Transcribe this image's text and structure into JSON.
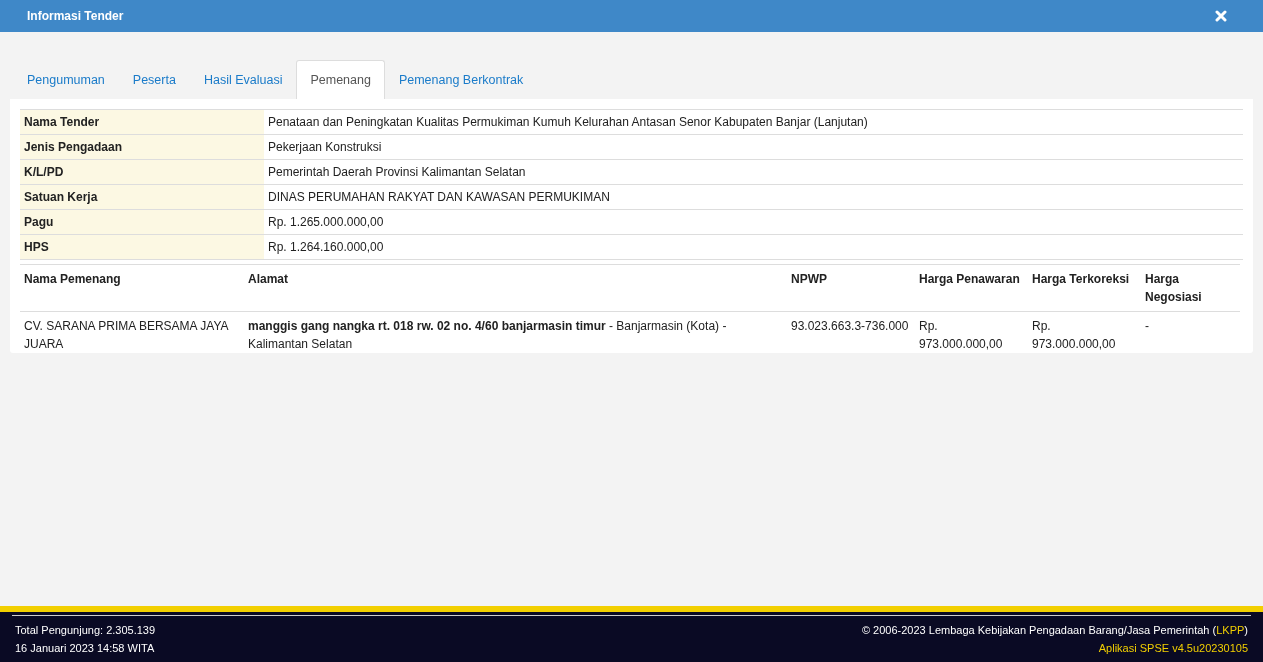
{
  "window": {
    "title": "Informasi Tender"
  },
  "tabs": [
    {
      "label": "Pengumuman",
      "selected": false
    },
    {
      "label": "Peserta",
      "selected": false
    },
    {
      "label": "Hasil Evaluasi",
      "selected": false
    },
    {
      "label": "Pemenang",
      "selected": true
    },
    {
      "label": "Pemenang Berkontrak",
      "selected": false
    }
  ],
  "info": [
    {
      "label": "Nama Tender",
      "value": "Penataan dan Peningkatan Kualitas Permukiman Kumuh Kelurahan Antasan Senor Kabupaten Banjar (Lanjutan)"
    },
    {
      "label": "Jenis Pengadaan",
      "value": "Pekerjaan Konstruksi"
    },
    {
      "label": "K/L/PD",
      "value": "Pemerintah Daerah Provinsi Kalimantan Selatan"
    },
    {
      "label": "Satuan Kerja",
      "value": "DINAS PERUMAHAN RAKYAT DAN KAWASAN PERMUKIMAN"
    },
    {
      "label": "Pagu",
      "value": "Rp. 1.265.000.000,00"
    },
    {
      "label": "HPS",
      "value": "Rp. 1.264.160.000,00"
    }
  ],
  "winners": {
    "columns": [
      "Nama Pemenang",
      "Alamat",
      "NPWP",
      "Harga Penawaran",
      "Harga Terkoreksi",
      "Harga Negosiasi"
    ],
    "rows": [
      [
        "CV. SARANA PRIMA BERSAMA JAYA JUARA",
        "**manggis gang nangka rt. 018 rw. 02 no. 4/60 banjarmasin timur** - Banjarmasin (Kota) - Kalimantan Selatan",
        "93.023.663.3-736.000",
        "Rp. 973.000.000,00",
        "Rp. 973.000.000,00",
        "-"
      ]
    ]
  },
  "footer": {
    "visitors": "Total Pengunjung: 2.305.139",
    "datetime": "16 Januari 2023 14:58 WITA",
    "copyright": "© 2006-2023 Lembaga Kebijakan Pengadaan Barang/Jasa Pemerintah (",
    "copyright_link": "LKPP",
    "copyright_end": ")",
    "version": "Aplikasi SPSE v4.5u20230105"
  }
}
